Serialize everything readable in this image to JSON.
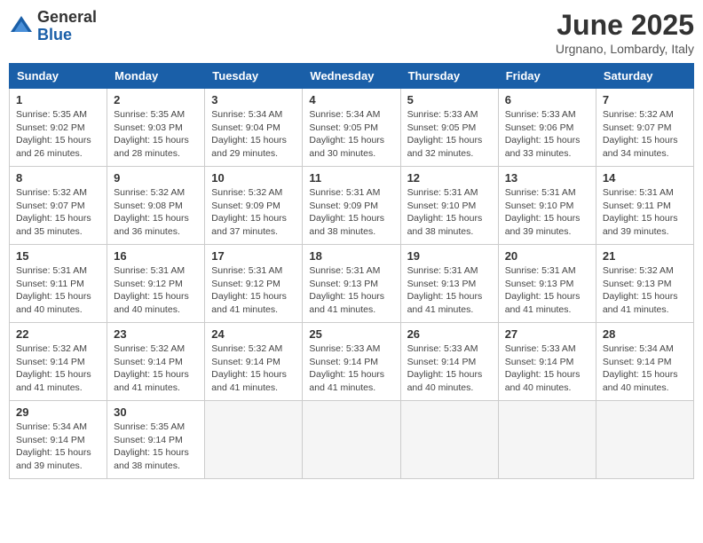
{
  "logo": {
    "general": "General",
    "blue": "Blue"
  },
  "title": "June 2025",
  "subtitle": "Urgnano, Lombardy, Italy",
  "headers": [
    "Sunday",
    "Monday",
    "Tuesday",
    "Wednesday",
    "Thursday",
    "Friday",
    "Saturday"
  ],
  "weeks": [
    [
      {
        "day": "1",
        "info": "Sunrise: 5:35 AM\nSunset: 9:02 PM\nDaylight: 15 hours\nand 26 minutes."
      },
      {
        "day": "2",
        "info": "Sunrise: 5:35 AM\nSunset: 9:03 PM\nDaylight: 15 hours\nand 28 minutes."
      },
      {
        "day": "3",
        "info": "Sunrise: 5:34 AM\nSunset: 9:04 PM\nDaylight: 15 hours\nand 29 minutes."
      },
      {
        "day": "4",
        "info": "Sunrise: 5:34 AM\nSunset: 9:05 PM\nDaylight: 15 hours\nand 30 minutes."
      },
      {
        "day": "5",
        "info": "Sunrise: 5:33 AM\nSunset: 9:05 PM\nDaylight: 15 hours\nand 32 minutes."
      },
      {
        "day": "6",
        "info": "Sunrise: 5:33 AM\nSunset: 9:06 PM\nDaylight: 15 hours\nand 33 minutes."
      },
      {
        "day": "7",
        "info": "Sunrise: 5:32 AM\nSunset: 9:07 PM\nDaylight: 15 hours\nand 34 minutes."
      }
    ],
    [
      {
        "day": "8",
        "info": "Sunrise: 5:32 AM\nSunset: 9:07 PM\nDaylight: 15 hours\nand 35 minutes."
      },
      {
        "day": "9",
        "info": "Sunrise: 5:32 AM\nSunset: 9:08 PM\nDaylight: 15 hours\nand 36 minutes."
      },
      {
        "day": "10",
        "info": "Sunrise: 5:32 AM\nSunset: 9:09 PM\nDaylight: 15 hours\nand 37 minutes."
      },
      {
        "day": "11",
        "info": "Sunrise: 5:31 AM\nSunset: 9:09 PM\nDaylight: 15 hours\nand 38 minutes."
      },
      {
        "day": "12",
        "info": "Sunrise: 5:31 AM\nSunset: 9:10 PM\nDaylight: 15 hours\nand 38 minutes."
      },
      {
        "day": "13",
        "info": "Sunrise: 5:31 AM\nSunset: 9:10 PM\nDaylight: 15 hours\nand 39 minutes."
      },
      {
        "day": "14",
        "info": "Sunrise: 5:31 AM\nSunset: 9:11 PM\nDaylight: 15 hours\nand 39 minutes."
      }
    ],
    [
      {
        "day": "15",
        "info": "Sunrise: 5:31 AM\nSunset: 9:11 PM\nDaylight: 15 hours\nand 40 minutes."
      },
      {
        "day": "16",
        "info": "Sunrise: 5:31 AM\nSunset: 9:12 PM\nDaylight: 15 hours\nand 40 minutes."
      },
      {
        "day": "17",
        "info": "Sunrise: 5:31 AM\nSunset: 9:12 PM\nDaylight: 15 hours\nand 41 minutes."
      },
      {
        "day": "18",
        "info": "Sunrise: 5:31 AM\nSunset: 9:13 PM\nDaylight: 15 hours\nand 41 minutes."
      },
      {
        "day": "19",
        "info": "Sunrise: 5:31 AM\nSunset: 9:13 PM\nDaylight: 15 hours\nand 41 minutes."
      },
      {
        "day": "20",
        "info": "Sunrise: 5:31 AM\nSunset: 9:13 PM\nDaylight: 15 hours\nand 41 minutes."
      },
      {
        "day": "21",
        "info": "Sunrise: 5:32 AM\nSunset: 9:13 PM\nDaylight: 15 hours\nand 41 minutes."
      }
    ],
    [
      {
        "day": "22",
        "info": "Sunrise: 5:32 AM\nSunset: 9:14 PM\nDaylight: 15 hours\nand 41 minutes."
      },
      {
        "day": "23",
        "info": "Sunrise: 5:32 AM\nSunset: 9:14 PM\nDaylight: 15 hours\nand 41 minutes."
      },
      {
        "day": "24",
        "info": "Sunrise: 5:32 AM\nSunset: 9:14 PM\nDaylight: 15 hours\nand 41 minutes."
      },
      {
        "day": "25",
        "info": "Sunrise: 5:33 AM\nSunset: 9:14 PM\nDaylight: 15 hours\nand 41 minutes."
      },
      {
        "day": "26",
        "info": "Sunrise: 5:33 AM\nSunset: 9:14 PM\nDaylight: 15 hours\nand 40 minutes."
      },
      {
        "day": "27",
        "info": "Sunrise: 5:33 AM\nSunset: 9:14 PM\nDaylight: 15 hours\nand 40 minutes."
      },
      {
        "day": "28",
        "info": "Sunrise: 5:34 AM\nSunset: 9:14 PM\nDaylight: 15 hours\nand 40 minutes."
      }
    ],
    [
      {
        "day": "29",
        "info": "Sunrise: 5:34 AM\nSunset: 9:14 PM\nDaylight: 15 hours\nand 39 minutes."
      },
      {
        "day": "30",
        "info": "Sunrise: 5:35 AM\nSunset: 9:14 PM\nDaylight: 15 hours\nand 38 minutes."
      },
      null,
      null,
      null,
      null,
      null
    ]
  ]
}
